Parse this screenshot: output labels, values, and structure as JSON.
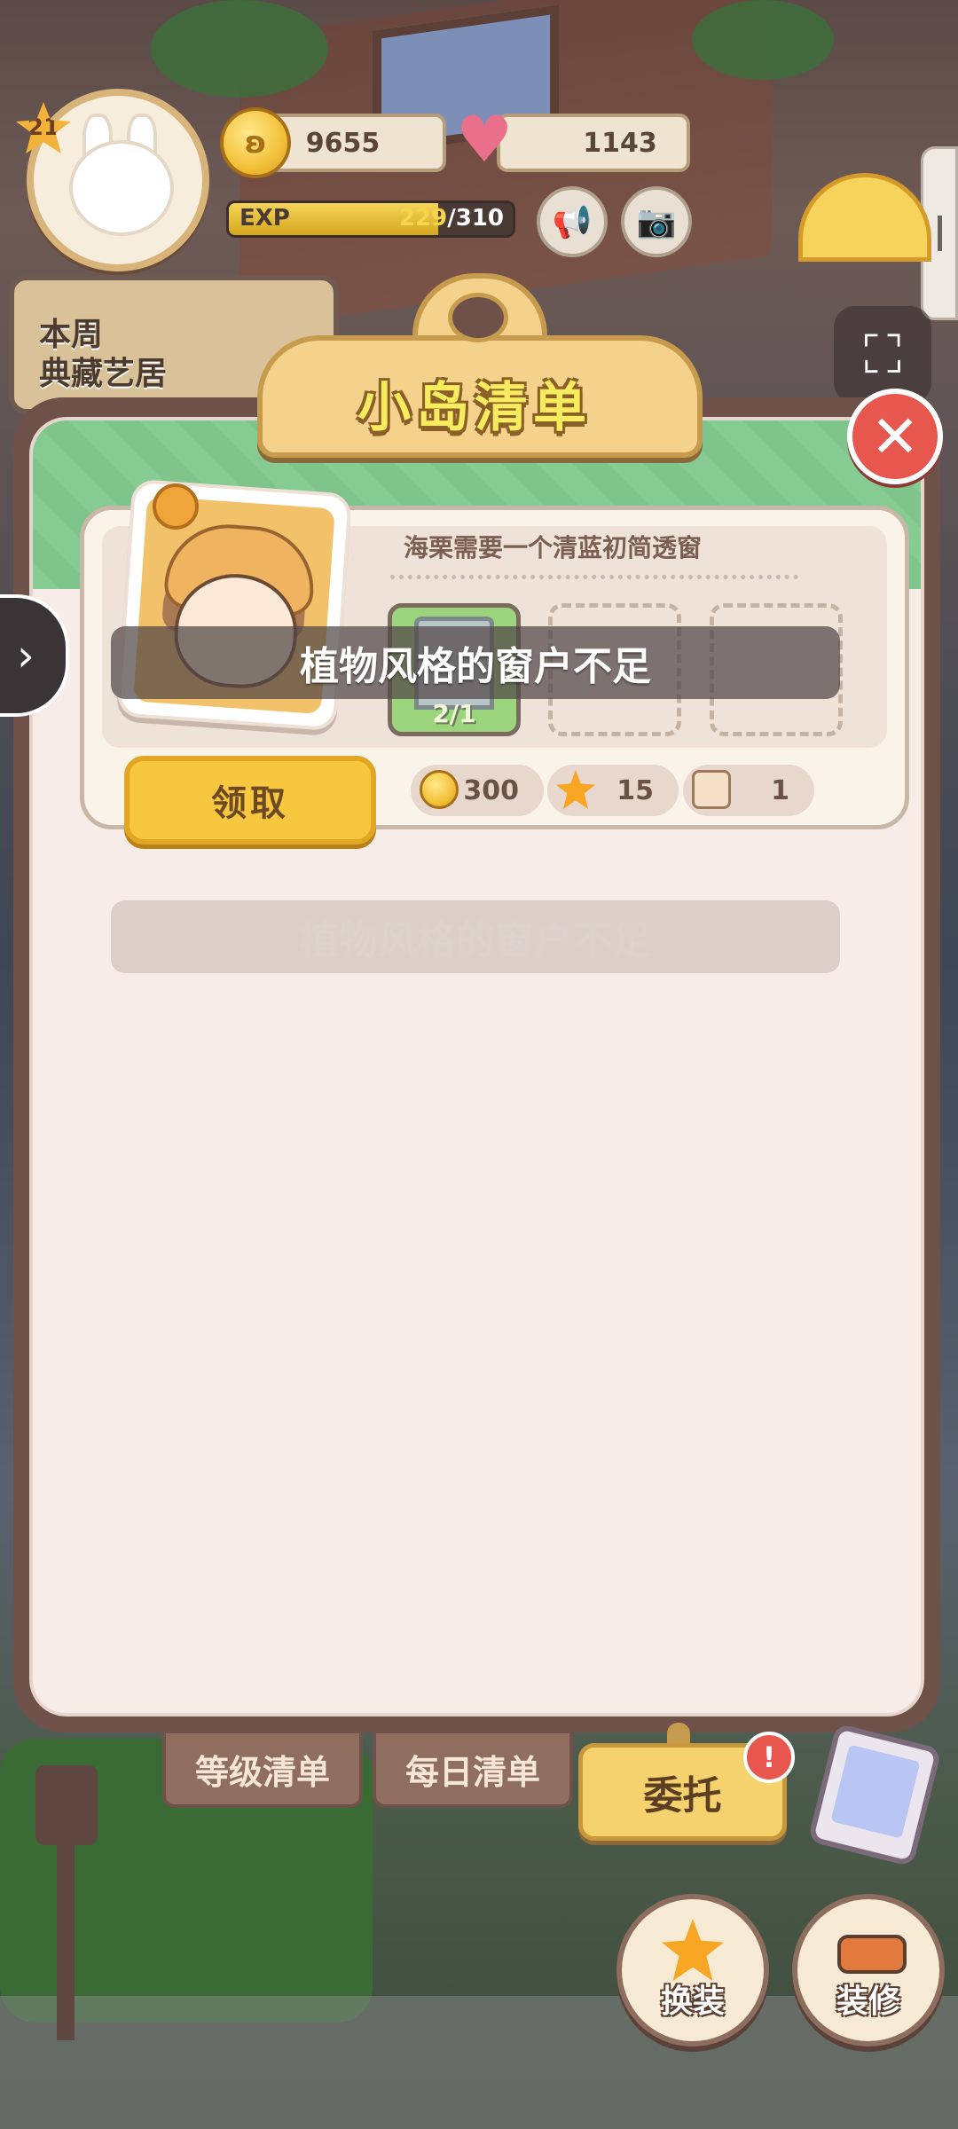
{
  "hud": {
    "level": "21",
    "coins": "9655",
    "hearts": "1143",
    "exp_label": "EXP",
    "exp_current": "229",
    "exp_max": "/310",
    "exp_progress": 0.739
  },
  "weekly": {
    "label_line1": "本周",
    "label_line2": "典藏艺居"
  },
  "panel": {
    "title": "小岛清单",
    "task": {
      "description": "海栗需要一个清蓝初简透窗",
      "slot_count": "2/1",
      "claim_label": "领取",
      "rewards": [
        {
          "icon": "coin-icon",
          "value": "300"
        },
        {
          "icon": "star-icon",
          "value": "15"
        },
        {
          "icon": "box-icon",
          "value": "1"
        }
      ]
    },
    "toast_primary": "植物风格的窗户不足",
    "toast_secondary": "植物风格的窗户不足"
  },
  "tabs": {
    "level_list": "等级清单",
    "daily_list": "每日清单",
    "commission": "委托",
    "alert": "!"
  },
  "actions": {
    "dress_up": "换装",
    "decorate": "装修"
  },
  "colors": {
    "accent_yellow": "#f7c740",
    "panel_brown": "#6e5149",
    "close_red": "#e7574d",
    "header_green": "#86cb91"
  }
}
